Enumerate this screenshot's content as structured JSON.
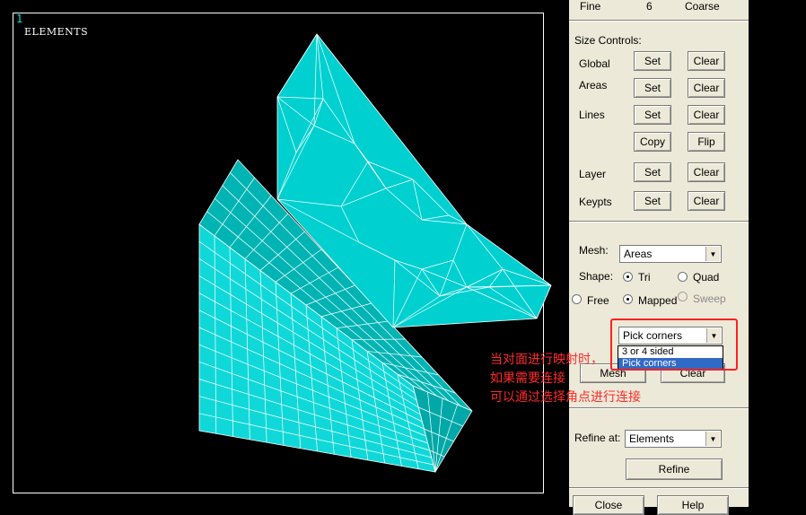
{
  "viewport": {
    "window_number": "1",
    "mode_label": "ELEMENTS",
    "mesh_color": "#00c8c8",
    "edge_color": "#ffffff"
  },
  "panel": {
    "smart_size": {
      "fine_label": "Fine",
      "value": "6",
      "coarse_label": "Coarse"
    },
    "size_controls_label": "Size Controls:",
    "rows": [
      {
        "label": "Global",
        "set": "Set",
        "clear": "Clear"
      },
      {
        "label": "Areas",
        "set": "Set",
        "clear": "Clear"
      },
      {
        "label": "Lines",
        "set": "Set",
        "clear": "Clear"
      },
      {
        "label": "",
        "set": "Copy",
        "clear": "Flip"
      },
      {
        "label": "Layer",
        "set": "Set",
        "clear": "Clear"
      },
      {
        "label": "Keypts",
        "set": "Set",
        "clear": "Clear"
      }
    ],
    "mesh_label": "Mesh:",
    "mesh_value": "Areas",
    "shape_label": "Shape:",
    "shape_tri": "Tri",
    "shape_quad": "Quad",
    "free": "Free",
    "mapped": "Mapped",
    "sweep": "Sweep",
    "corner_select_value": "Pick corners",
    "corner_options": [
      "3 or 4 sided",
      "Pick corners"
    ],
    "mesh_button": "Mesh",
    "clear_button": "Clear",
    "refine_label": "Refine at:",
    "refine_value": "Elements",
    "refine_button": "Refine",
    "close_button": "Close",
    "help_button": "Help"
  },
  "annotation": {
    "color": "#ff2a2a",
    "lines": [
      "当对面进行映射时，",
      "如果需要连接",
      "可以通过选择角点进行连接"
    ]
  }
}
